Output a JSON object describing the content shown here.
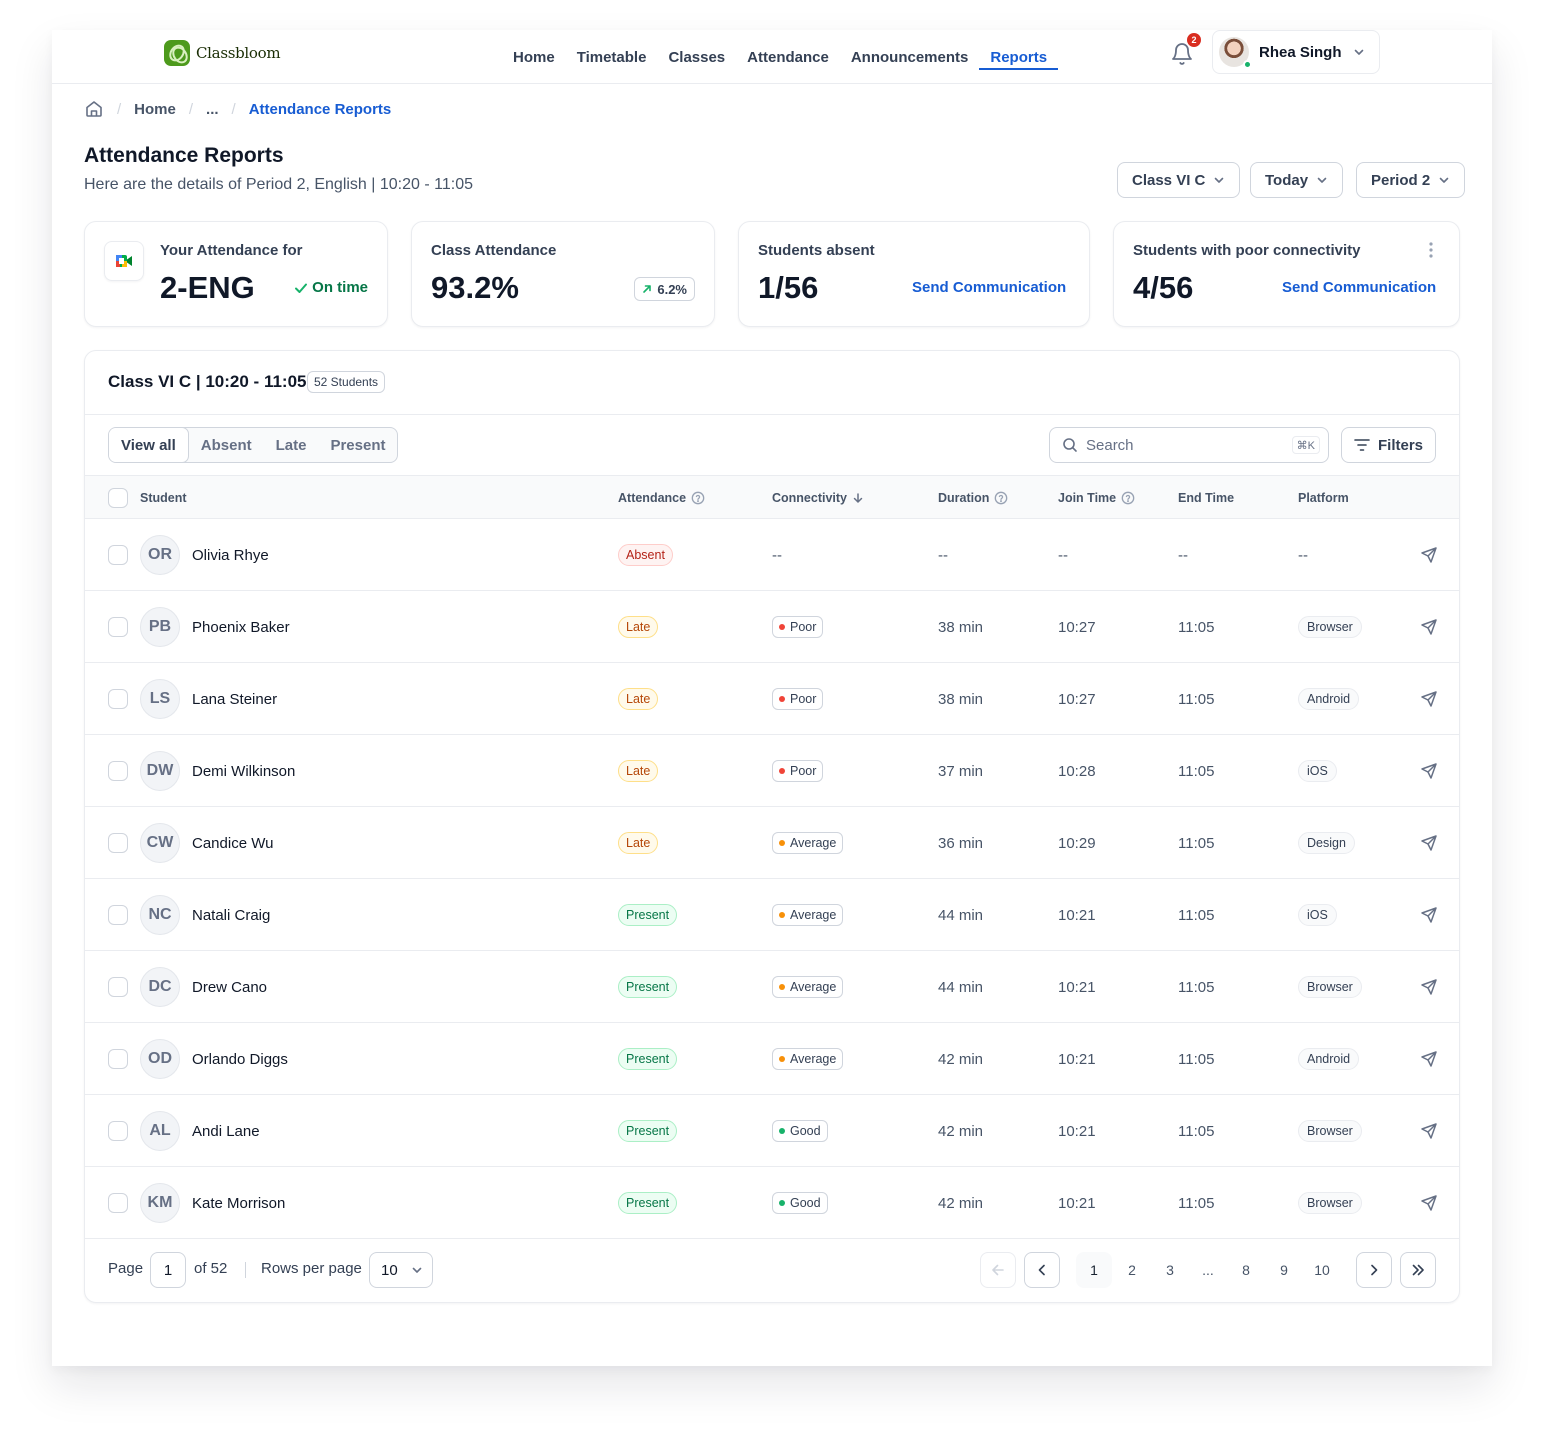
{
  "app": {
    "name": "Classbloom"
  },
  "nav": {
    "links": [
      "Home",
      "Timetable",
      "Classes",
      "Attendance",
      "Announcements",
      "Reports"
    ],
    "active": "Reports",
    "notifications_count": "2",
    "user_name": "Rhea Singh"
  },
  "breadcrumb": {
    "home": "Home",
    "ellipsis": "...",
    "current": "Attendance Reports"
  },
  "header": {
    "title": "Attendance Reports",
    "subtitle": "Here are the details of Period 2, English | 10:20 - 11:05",
    "filters": {
      "class": "Class VI C",
      "day": "Today",
      "period": "Period 2"
    }
  },
  "cards": {
    "your_attendance": {
      "label": "Your Attendance for",
      "value": "2-ENG",
      "status": "On time"
    },
    "class_attendance": {
      "label": "Class Attendance",
      "value": "93.2%",
      "trend": "6.2%"
    },
    "absent": {
      "label": "Students absent",
      "value": "1/56",
      "link": "Send Communication"
    },
    "connectivity": {
      "label": "Students with poor connectivity",
      "value": "4/56",
      "link": "Send Communication"
    }
  },
  "table": {
    "title": "Class VI C | 10:20 - 11:05",
    "count_badge": "52 Students",
    "tabs": [
      "View all",
      "Absent",
      "Late",
      "Present"
    ],
    "active_tab": "View all",
    "search_placeholder": "Search",
    "search_shortcut": "⌘K",
    "filters_label": "Filters",
    "columns": [
      "Student",
      "Attendance",
      "Connectivity",
      "Duration",
      "Join Time",
      "End Time",
      "Platform"
    ],
    "rows": [
      {
        "initials": "OR",
        "name": "Olivia Rhye",
        "attendance": "Absent",
        "connectivity": "--",
        "duration": "--",
        "join": "--",
        "end": "--",
        "platform": "--"
      },
      {
        "initials": "PB",
        "name": "Phoenix Baker",
        "attendance": "Late",
        "connectivity": "Poor",
        "duration": "38 min",
        "join": "10:27",
        "end": "11:05",
        "platform": "Browser"
      },
      {
        "initials": "LS",
        "name": "Lana Steiner",
        "attendance": "Late",
        "connectivity": "Poor",
        "duration": "38 min",
        "join": "10:27",
        "end": "11:05",
        "platform": "Android"
      },
      {
        "initials": "DW",
        "name": "Demi Wilkinson",
        "attendance": "Late",
        "connectivity": "Poor",
        "duration": "37 min",
        "join": "10:28",
        "end": "11:05",
        "platform": "iOS"
      },
      {
        "initials": "CW",
        "name": "Candice Wu",
        "attendance": "Late",
        "connectivity": "Average",
        "duration": "36 min",
        "join": "10:29",
        "end": "11:05",
        "platform": "Design"
      },
      {
        "initials": "NC",
        "name": "Natali Craig",
        "attendance": "Present",
        "connectivity": "Average",
        "duration": "44 min",
        "join": "10:21",
        "end": "11:05",
        "platform": "iOS"
      },
      {
        "initials": "DC",
        "name": "Drew Cano",
        "attendance": "Present",
        "connectivity": "Average",
        "duration": "44 min",
        "join": "10:21",
        "end": "11:05",
        "platform": "Browser"
      },
      {
        "initials": "OD",
        "name": "Orlando Diggs",
        "attendance": "Present",
        "connectivity": "Average",
        "duration": "42 min",
        "join": "10:21",
        "end": "11:05",
        "platform": "Android"
      },
      {
        "initials": "AL",
        "name": "Andi Lane",
        "attendance": "Present",
        "connectivity": "Good",
        "duration": "42 min",
        "join": "10:21",
        "end": "11:05",
        "platform": "Browser"
      },
      {
        "initials": "KM",
        "name": "Kate Morrison",
        "attendance": "Present",
        "connectivity": "Good",
        "duration": "42 min",
        "join": "10:21",
        "end": "11:05",
        "platform": "Browser"
      }
    ]
  },
  "pagination": {
    "page_label": "Page",
    "current_page": "1",
    "of_label": "of 52",
    "rows_label": "Rows per page",
    "rows_value": "10",
    "pages": [
      "1",
      "2",
      "3",
      "...",
      "8",
      "9",
      "10"
    ]
  },
  "colors": {
    "accent": "#175cd3",
    "brand": "#4d9a1c",
    "poor": "#f04438",
    "average": "#f79009",
    "good": "#17b26a"
  }
}
